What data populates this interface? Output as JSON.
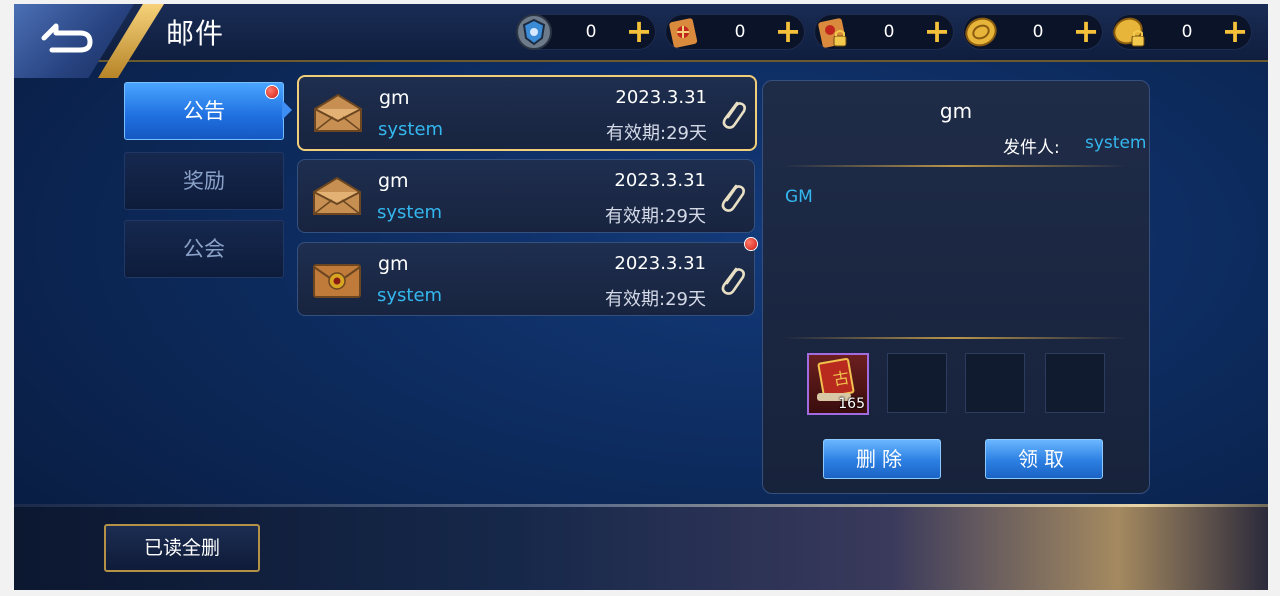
{
  "header": {
    "title": "邮件",
    "resources": [
      {
        "icon": "shield-coin-icon",
        "value": "0"
      },
      {
        "icon": "scroll-icon",
        "value": "0"
      },
      {
        "icon": "locked-scroll-icon",
        "value": "0"
      },
      {
        "icon": "gold-coin-icon",
        "value": "0"
      },
      {
        "icon": "locked-coin-icon",
        "value": "0"
      }
    ],
    "plus_label": "+"
  },
  "tabs": [
    {
      "label": "公告",
      "active": true,
      "unread": true
    },
    {
      "label": "奖励",
      "active": false,
      "unread": false
    },
    {
      "label": "公会",
      "active": false,
      "unread": false
    }
  ],
  "mails": [
    {
      "sender": "gm",
      "from": "system",
      "date": "2023.3.31",
      "expiry": "有效期:29天",
      "selected": true,
      "unread": false,
      "icon": "envelope-open-icon"
    },
    {
      "sender": "gm",
      "from": "system",
      "date": "2023.3.31",
      "expiry": "有效期:29天",
      "selected": false,
      "unread": false,
      "icon": "envelope-open-icon"
    },
    {
      "sender": "gm",
      "from": "system",
      "date": "2023.3.31",
      "expiry": "有效期:29天",
      "selected": false,
      "unread": true,
      "icon": "envelope-sealed-icon"
    }
  ],
  "detail": {
    "title": "gm",
    "sender_label": "发件人:",
    "sender": "system",
    "body": "GM",
    "attachment_count": "165",
    "delete_label": "删除",
    "claim_label": "领取"
  },
  "footer": {
    "read_delete_label": "已读全删"
  },
  "colors": {
    "accent_blue": "#34b7ee",
    "gold": "#f1cf7a",
    "unread_dot": "#d31b12"
  }
}
